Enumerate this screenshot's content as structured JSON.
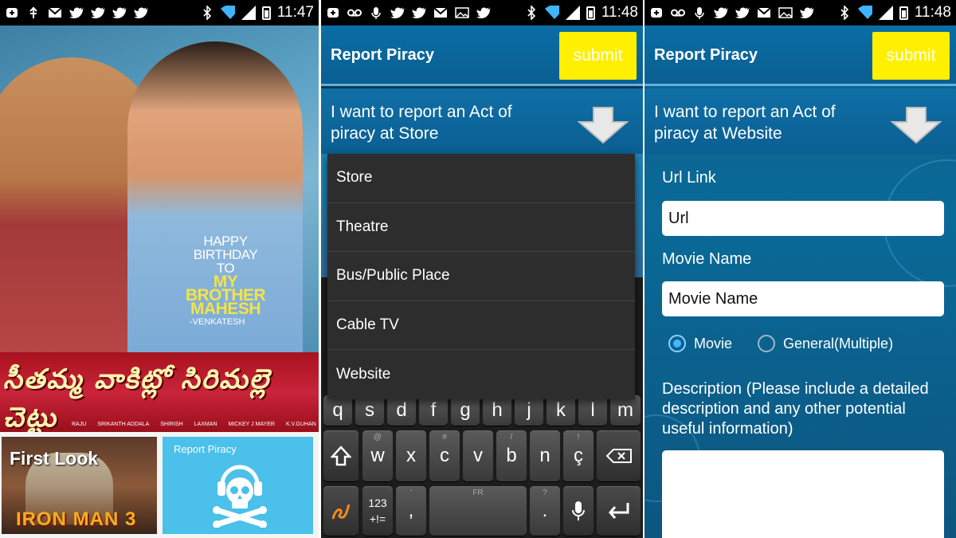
{
  "status": {
    "p1_time": "11:47",
    "p2_time": "11:48",
    "p3_time": "11:48"
  },
  "panel1": {
    "poster": {
      "line1": "HAPPY",
      "line2": "BIRTHDAY",
      "line3": "TO",
      "line4": "MY BROTHER",
      "line5": "MAHESH",
      "signature": "-VENKATESH"
    },
    "banner": {
      "title": "సీతమ్మ వాకిట్లో సిరిమల్లె చెట్టు",
      "credits": [
        "RAJU",
        "SRIKANTH ADDALA",
        "SHIRISH",
        "LAXMAN",
        "MICKEY J MAYER",
        "K.V.GUHAN"
      ]
    },
    "tile_first_look": {
      "label": "First Look",
      "movie": "IRON MAN 3"
    },
    "tile_report": {
      "label": "Report Piracy"
    }
  },
  "app": {
    "title": "Report Piracy",
    "submit_label": "submit"
  },
  "panel2": {
    "selector_text": "I want to report an Act of piracy at Store",
    "dropdown_options": [
      "Store",
      "Theatre",
      "Bus/Public Place",
      "Cable TV",
      "Website"
    ],
    "keyboard": {
      "row1": [
        "q",
        "s",
        "d",
        "f",
        "g",
        "h",
        "j",
        "k",
        "l",
        "m"
      ],
      "row2": [
        "w",
        "x",
        "c",
        "v",
        "b",
        "n",
        "ç"
      ],
      "row2_sup": [
        "@",
        "",
        "#",
        "",
        "/",
        "",
        "!"
      ],
      "sym_label_top": "123",
      "sym_label_bottom": "+!=",
      "comma": ",",
      "comma_sup": "'",
      "space_label": "FR",
      "period": ".",
      "period_sup": "?"
    }
  },
  "panel3": {
    "selector_text": "I want to report an Act of piracy at Website",
    "url_label": "Url Link",
    "url_value": "Url",
    "movie_label": "Movie Name",
    "movie_value": "Movie Name",
    "radio_movie": "Movie",
    "radio_general": "General(Multiple)",
    "description_label": "Description (Please include a detailed description and any other potential useful information)"
  },
  "colors": {
    "accent_blue": "#0a6ea6",
    "submit_yellow": "#ffef00",
    "tile_blue": "#4ac0ea"
  }
}
